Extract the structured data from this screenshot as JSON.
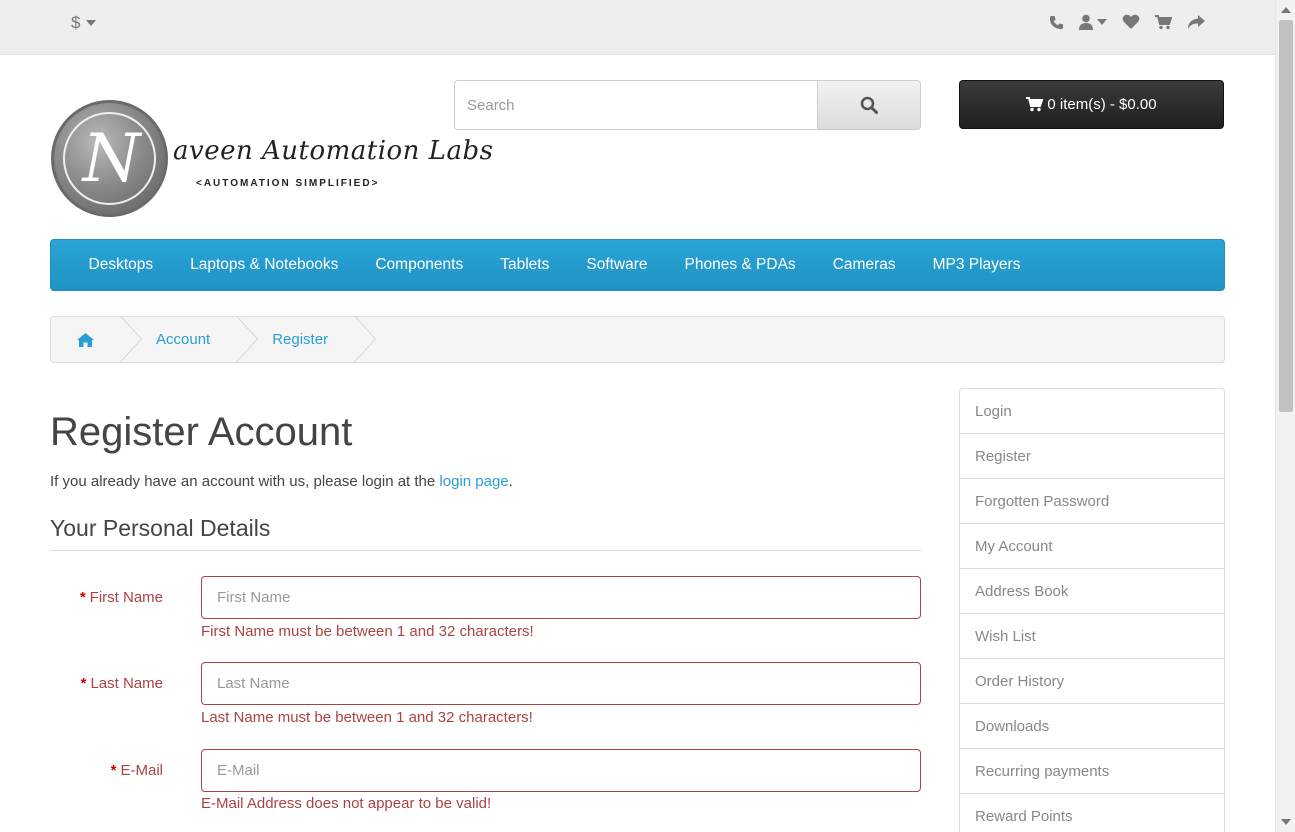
{
  "topbar": {
    "currency_symbol": "$",
    "icons": [
      "phone-icon",
      "user-icon",
      "heart-icon",
      "cart-icon",
      "share-icon"
    ]
  },
  "logo": {
    "letter": "N",
    "name": "aveen Automation Labs",
    "tagline": "<AUTOMATION SIMPLIFIED>"
  },
  "search": {
    "placeholder": "Search"
  },
  "cart": {
    "label": "0 item(s) - $0.00"
  },
  "menu": {
    "items": [
      "Desktops",
      "Laptops & Notebooks",
      "Components",
      "Tablets",
      "Software",
      "Phones & PDAs",
      "Cameras",
      "MP3 Players"
    ]
  },
  "breadcrumb": {
    "items": [
      "Account",
      "Register"
    ]
  },
  "page": {
    "title": "Register Account",
    "intro_text": "If you already have an account with us, please login at the ",
    "intro_link": "login page",
    "intro_end": ".",
    "section_title": "Your Personal Details"
  },
  "form": {
    "fields": [
      {
        "label": "First Name",
        "placeholder": "First Name",
        "error": "First Name must be between 1 and 32 characters!"
      },
      {
        "label": "Last Name",
        "placeholder": "Last Name",
        "error": "Last Name must be between 1 and 32 characters!"
      },
      {
        "label": "E-Mail",
        "placeholder": "E-Mail",
        "error": "E-Mail Address does not appear to be valid!"
      }
    ],
    "required_mark": "*"
  },
  "sidebar": {
    "items": [
      "Login",
      "Register",
      "Forgotten Password",
      "My Account",
      "Address Book",
      "Wish List",
      "Order History",
      "Downloads",
      "Recurring payments",
      "Reward Points"
    ]
  },
  "colors": {
    "menu_blue": "#229ac8",
    "link_blue": "#2a9fd6",
    "error_red": "#a94442"
  }
}
